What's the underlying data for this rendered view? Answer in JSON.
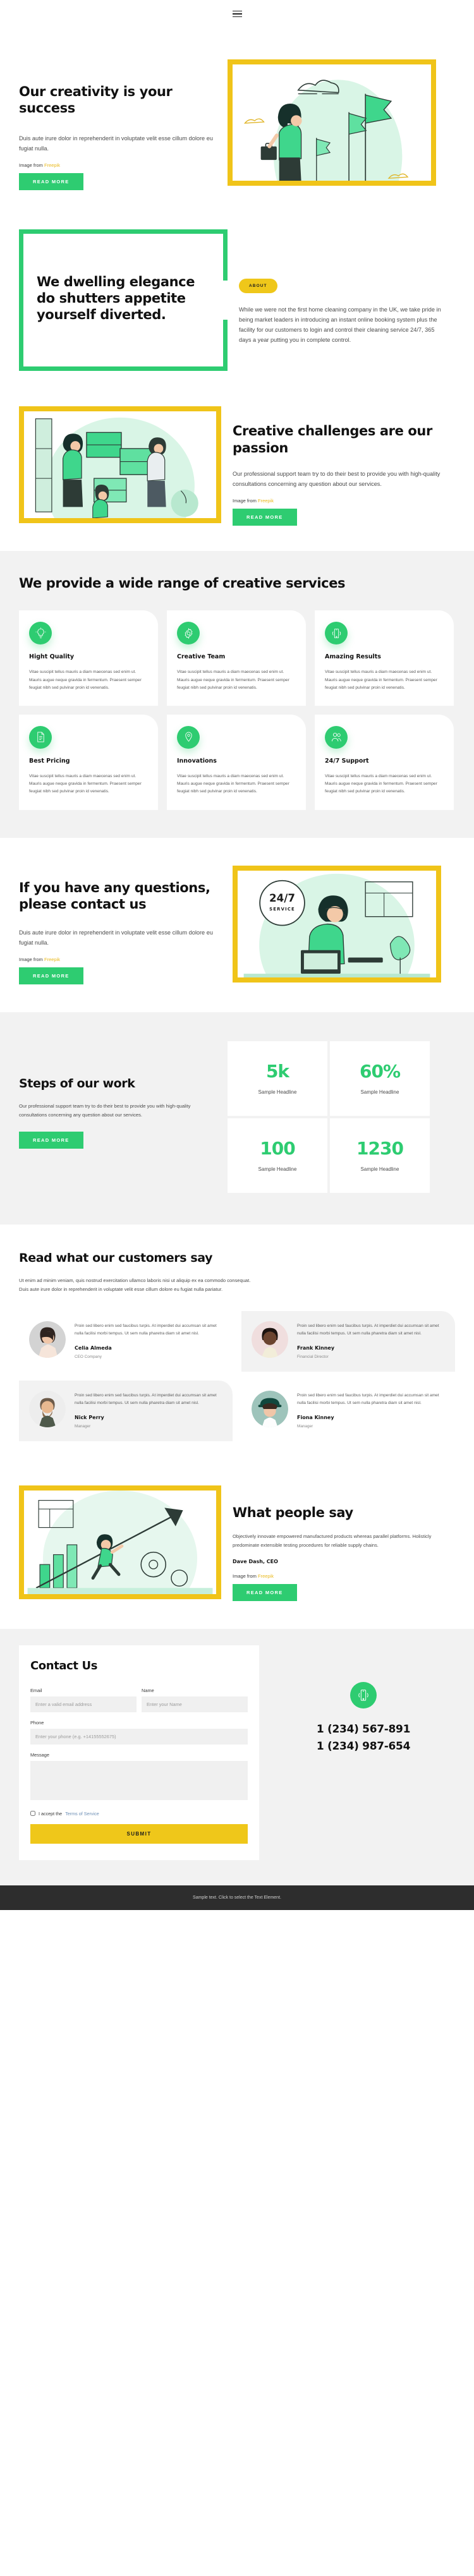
{
  "header": {
    "menu_icon": "hamburger-menu-icon"
  },
  "hero": {
    "title": "Our creativity is your success",
    "paragraph": "Duis aute irure dolor in reprehenderit in voluptate velit esse cillum dolore eu fugiat nulla.",
    "credit_prefix": "Image from ",
    "credit_link": "Freepik",
    "button": "READ MORE"
  },
  "quote": {
    "title": "We dwelling elegance do shutters appetite yourself diverted.",
    "badge": "ABOUT",
    "paragraph": "While we were not the first home cleaning company in the UK, we take pride in being market leaders in introducing an instant online booking system plus the facility for our customers to login and control their cleaning service 24/7, 365 days a year putting you in complete control."
  },
  "challenges": {
    "title": "Creative challenges are our passion",
    "paragraph": "Our professional support team try to do their best to provide you with high-quality consultations concerning any question about our services.",
    "credit_prefix": "Image from ",
    "credit_link": "Freepik",
    "button": "READ MORE"
  },
  "services": {
    "title": "We provide a wide range of creative services",
    "body_text": "Vitae suscipit tellus mauris a diam maecenas sed enim ut. Mauris augue neque gravida in fermentum. Praesent semper feugiat nibh sed pulvinar proin id venenatis.",
    "cards": [
      {
        "title": "Hight Quality",
        "icon": "lightbulb-icon"
      },
      {
        "title": "Creative Team",
        "icon": "gear-icon"
      },
      {
        "title": "Amazing Results",
        "icon": "mobile-phone-icon"
      },
      {
        "title": "Best Pricing",
        "icon": "document-list-icon"
      },
      {
        "title": "Innovations",
        "icon": "location-pin-icon"
      },
      {
        "title": "24/7 Support",
        "icon": "people-icon"
      }
    ]
  },
  "cta": {
    "title": "If you have any questions, please contact us",
    "paragraph": "Duis aute irure dolor in reprehenderit in voluptate velit esse cillum dolore eu fugiat nulla.",
    "credit_prefix": "Image from ",
    "credit_link": "Freepik",
    "button": "READ MORE",
    "illustration_label_top": "24/7",
    "illustration_label_bottom": "SERVICE"
  },
  "steps": {
    "title": "Steps of our work",
    "paragraph": "Our professional support team try to do their best to provide you with high-quality consultations concerning any question about our services.",
    "button": "READ MORE",
    "stats": [
      {
        "value": "5k",
        "label": "Sample Headline"
      },
      {
        "value": "60%",
        "label": "Sample Headline"
      },
      {
        "value": "100",
        "label": "Sample Headline"
      },
      {
        "value": "1230",
        "label": "Sample Headline"
      }
    ]
  },
  "testimonials": {
    "title": "Read what our customers say",
    "intro": "Ut enim ad minim veniam, quis nostrud exercitation ullamco laboris nisi ut aliquip ex ea commodo consequat. Duis aute irure dolor in reprehenderit in voluptate velit esse cillum dolore eu fugiat nulla pariatur.",
    "quote_text": "Proin sed libero enim sed faucibus turpis. At imperdiet dui accumsan sit amet nulla facilisi morbi tempus. Ut sem nulla pharetra diam sit amet nisl.",
    "items": [
      {
        "name": "Celia Almeda",
        "role": "CEO Company",
        "shaded": false
      },
      {
        "name": "Frank Kinney",
        "role": "Financial Director",
        "shaded": true
      },
      {
        "name": "Nick Perry",
        "role": "Manager",
        "shaded": true
      },
      {
        "name": "Fiona Kinney",
        "role": "Manager",
        "shaded": false
      }
    ]
  },
  "people_say": {
    "title": "What people say",
    "paragraph": "Objectively innovate empowered manufactured products whereas parallel platforms. Holisticly predominate extensible testing procedures for reliable supply chains.",
    "name": "Dave Dash, CEO",
    "credit_prefix": "Image from ",
    "credit_link": "Freepik",
    "button": "READ MORE"
  },
  "contact": {
    "title": "Contact Us",
    "email_label": "Email",
    "email_placeholder": "Enter a valid email address",
    "name_label": "Name",
    "name_placeholder": "Enter your Name",
    "phone_label": "Phone",
    "phone_placeholder": "Enter your phone (e.g. +14155552675)",
    "message_label": "Message",
    "message_placeholder": "",
    "terms_prefix": "I accept the ",
    "terms_link": "Terms of Service",
    "submit": "SUBMIT",
    "phone_icon": "mobile-phone-icon",
    "phone_1": "1 (234) 567-891",
    "phone_2": "1 (234) 987-654"
  },
  "footer": {
    "text": "Sample text. Click to select the Text Element."
  },
  "colors": {
    "green": "#2ecc71",
    "yellow": "#efc71a",
    "mint": "#d9f5e6",
    "dark": "#2d2d2d"
  }
}
